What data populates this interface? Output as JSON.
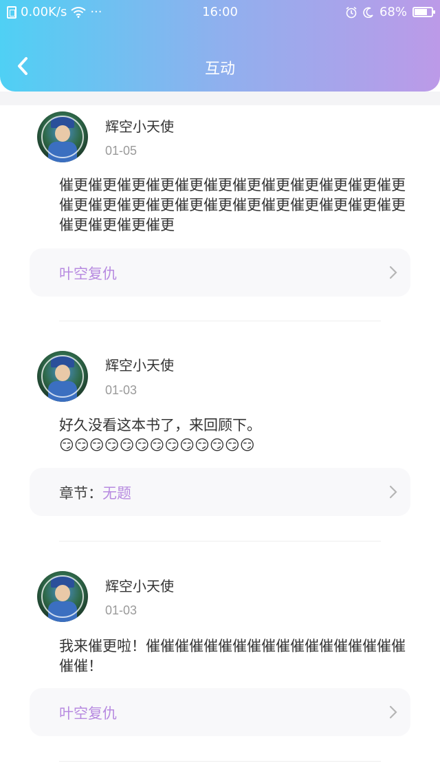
{
  "status_bar": {
    "net_speed": "0.00K/s",
    "more": "···",
    "time": "16:00",
    "battery": "68%"
  },
  "nav": {
    "title": "互动"
  },
  "comments": [
    {
      "username": "辉空小天使",
      "date": "01-05",
      "text": "催更催更催更催更催更催更催更催更催更催更催更催更催更催更催更催更催更催更催更催更催更催更催更催更催更催更催更催更",
      "link_prefix": "",
      "link_label": "叶空复仇"
    },
    {
      "username": "辉空小天使",
      "date": "01-03",
      "text": "好久没看这本书了，来回顾下。😏😏😏😏😏😏😏😏😏😏😏😏😏😏",
      "link_prefix": "章节：",
      "link_label": "无题"
    },
    {
      "username": "辉空小天使",
      "date": "01-03",
      "text": "我来催更啦！催催催催催催催催催催催催催催催催催催催催！",
      "link_prefix": "",
      "link_label": "叶空复仇"
    }
  ],
  "colors": {
    "header_start": "#4fd0f4",
    "header_end": "#bc9ae8",
    "link_accent": "#b78ae0"
  }
}
